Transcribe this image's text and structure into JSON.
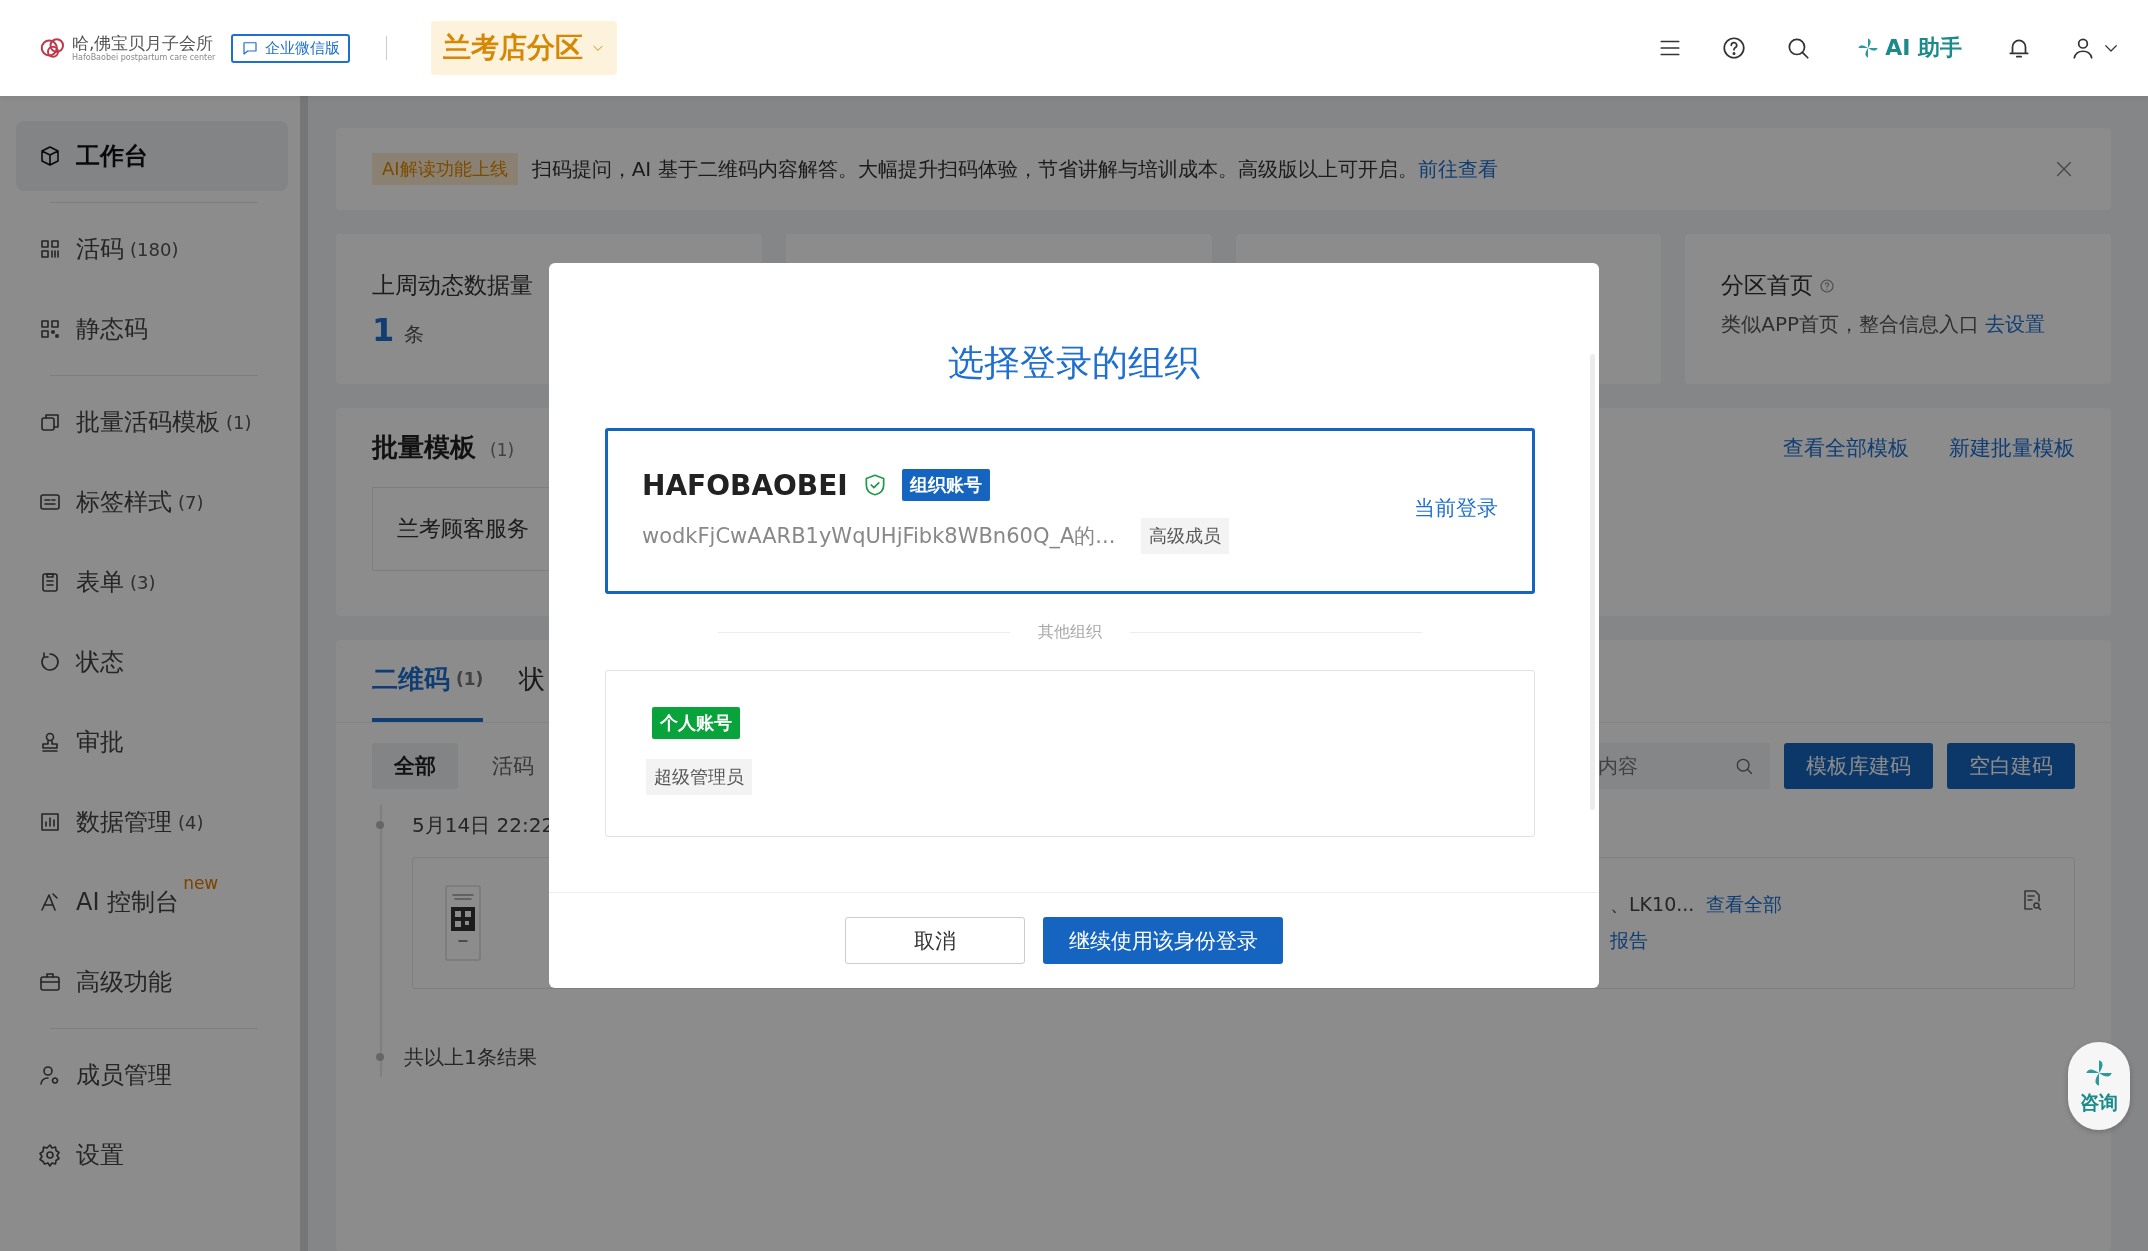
{
  "header": {
    "logo_text": "哈,佛宝贝月子会所",
    "logo_subtext": "HafoBaobei postpartum care center",
    "edition_badge": "企业微信版",
    "branch": "兰考店分区",
    "ai_button": "AI 助手"
  },
  "sidebar": {
    "groups": [
      {
        "items": [
          {
            "label": "工作台",
            "selected": true
          }
        ]
      },
      {
        "items": [
          {
            "label": "活码",
            "count": "(180)",
            "selected": false
          },
          {
            "label": "静态码",
            "selected": false
          }
        ]
      },
      {
        "items": [
          {
            "label": "批量活码模板",
            "count": "(1)",
            "selected": false
          },
          {
            "label": "标签样式",
            "count": "(7)",
            "selected": false
          },
          {
            "label": "表单",
            "count": "(3)",
            "selected": false
          },
          {
            "label": "状态",
            "selected": false
          },
          {
            "label": "审批",
            "selected": false
          },
          {
            "label": "数据管理",
            "count": "(4)",
            "selected": false
          },
          {
            "label": "AI 控制台",
            "badge": "new",
            "selected": false
          },
          {
            "label": "高级功能",
            "selected": false
          }
        ]
      },
      {
        "items": [
          {
            "label": "成员管理",
            "selected": false
          },
          {
            "label": "设置",
            "selected": false
          }
        ]
      }
    ]
  },
  "banner": {
    "tag": "AI解读功能上线",
    "text": "扫码提问，AI 基于二维码内容解答。大幅提升扫码体验，节省讲解与培训成本。高级版以上可开启。",
    "link": "前往查看"
  },
  "stat_cards": [
    {
      "kind": "metric",
      "title": "上周动态数据量",
      "value": "1",
      "unit": "条"
    },
    {
      "kind": "blank"
    },
    {
      "kind": "blank"
    },
    {
      "kind": "entry",
      "title": "分区首页",
      "description": "类似APP首页，整合信息入口",
      "link": "去设置"
    }
  ],
  "batch_templates": {
    "title": "批量模板",
    "count": "(1)",
    "links": [
      "查看全部模板",
      "新建批量模板"
    ],
    "items": [
      "兰考顾客服务"
    ]
  },
  "qr_section": {
    "tabs": [
      {
        "label": "二维码",
        "count": "(1)",
        "selected": true
      },
      {
        "label": "状",
        "selected": false
      }
    ],
    "filters": [
      {
        "label": "全部",
        "selected": true
      },
      {
        "label": "活码",
        "selected": false
      }
    ],
    "search": {
      "placeholder": "内容"
    },
    "buttons": [
      "模板库建码",
      "空白建码"
    ],
    "date": "5月14日 22:22",
    "record": {
      "summary": "、LK10...",
      "link": "查看全部",
      "note": "报告"
    },
    "footer": "共以上1条结果"
  },
  "consult": {
    "label": "咨询"
  },
  "dialog": {
    "title": "选择登录的组织",
    "current": {
      "name": "HAFOBAOBEI",
      "verified": true,
      "badge": "组织账号",
      "id": "wodkFjCwAARB1yWqUHjFibk8WBn60Q_A的...",
      "role": "高级成员",
      "status": "当前登录",
      "selected": true
    },
    "divider": "其他组织",
    "others": [
      {
        "badge": "个人账号",
        "role": "超级管理员",
        "selected": false
      }
    ],
    "buttons": [
      {
        "label": "取消",
        "kind": "secondary"
      },
      {
        "label": "继续使用该身份登录",
        "kind": "primary"
      }
    ]
  }
}
